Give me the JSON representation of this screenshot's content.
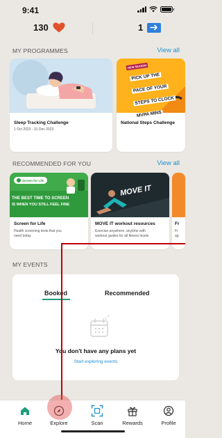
{
  "status_bar": {
    "time": "9:41"
  },
  "counters": {
    "hearts": "130",
    "tickets": "1"
  },
  "programmes": {
    "title": "MY PROGRAMMES",
    "view_all": "View all",
    "cards": [
      {
        "title": "Sleep Tracking Challenge",
        "dates": "1 Oct 2023 - 31 Dec 2023"
      },
      {
        "title": "National Steps Challenge",
        "banner": [
          "PICK UP THE",
          "PACE OF YOUR",
          "STEPS TO CLOCK",
          "MVPA MINS"
        ],
        "tag": "NEW SEASON"
      }
    ]
  },
  "recommended": {
    "title": "RECOMMENDED FOR YOU",
    "view_all": "View all",
    "cards": [
      {
        "title": "Screen for Life",
        "desc": [
          "Health screening tests that you",
          "need today"
        ],
        "logo": "Screen for Life",
        "banner": [
          "THE BEST TIME TO SCREEN",
          "IS WHEN YOU STILL FEEL FINE"
        ]
      },
      {
        "title": "MOVE IT workout resources",
        "desc": [
          "Exercise anywhere, anytime with",
          "workout guides for all fitness levels"
        ],
        "banner": "MOVE IT"
      },
      {
        "title": "Fr",
        "desc": [
          "Fr",
          "ag"
        ]
      }
    ]
  },
  "events": {
    "title": "MY EVENTS",
    "tabs": [
      "Booked",
      "Recommended"
    ],
    "empty_message": "You don't have any plans yet",
    "cta": "Start exploring events"
  },
  "nav": {
    "items": [
      "Home",
      "Explore",
      "Scan",
      "Rewards",
      "Profile"
    ]
  },
  "colors": {
    "background": "#ebe8e3",
    "accent_green": "#1f9e7a",
    "link_blue": "#1e8fd0",
    "heart_red": "#e2502b"
  }
}
